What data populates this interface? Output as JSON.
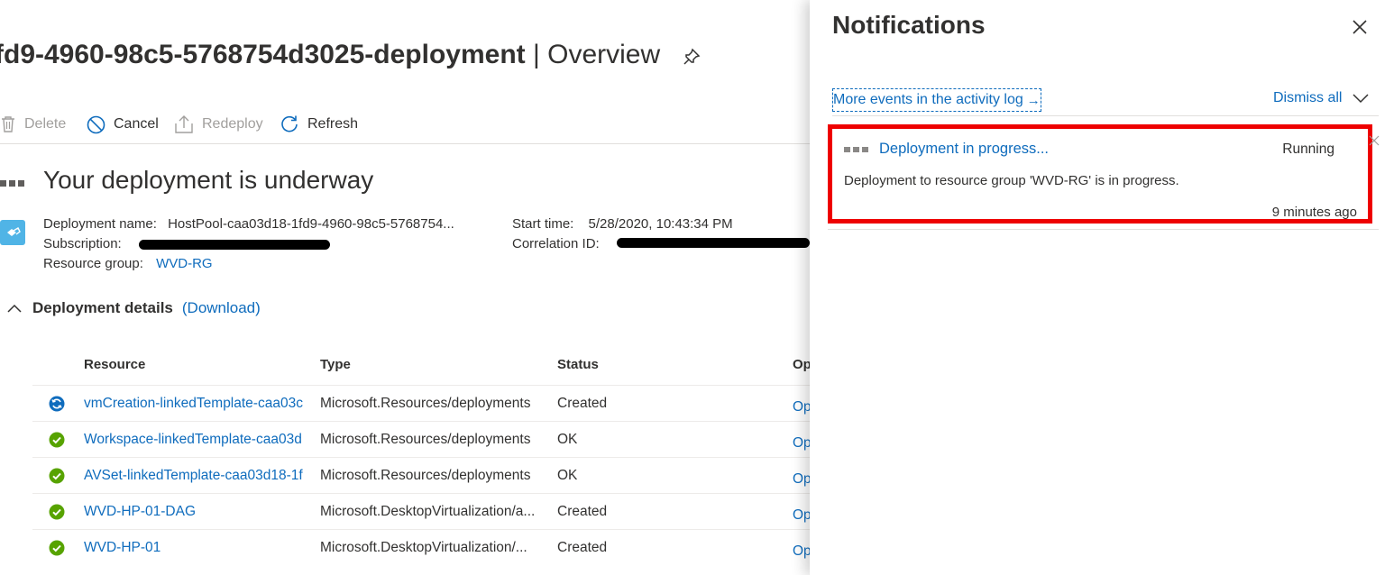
{
  "header": {
    "title_main": "fd9-4960-98c5-5768754d3025-deployment",
    "title_sep": " | ",
    "title_suffix": "Overview"
  },
  "toolbar": {
    "delete_label": "Delete",
    "cancel_label": "Cancel",
    "redeploy_label": "Redeploy",
    "refresh_label": "Refresh"
  },
  "status": {
    "headline": "Your deployment is underway"
  },
  "info": {
    "deployment_name_label": "Deployment name:",
    "deployment_name_value": "HostPool-caa03d18-1fd9-4960-98c5-5768754...",
    "subscription_label": "Subscription:",
    "resource_group_label": "Resource group:",
    "resource_group_value": "WVD-RG",
    "start_time_label": "Start time:",
    "start_time_value": "5/28/2020, 10:43:34 PM",
    "correlation_id_label": "Correlation ID:"
  },
  "details": {
    "collapse_glyph": "^",
    "title": "Deployment details",
    "download_label": "(Download)"
  },
  "table": {
    "headers": [
      "Resource",
      "Type",
      "Status",
      "Op"
    ],
    "rows": [
      {
        "icon": "sync-icon",
        "resource": "vmCreation-linkedTemplate-caa03c",
        "type": "Microsoft.Resources/deployments",
        "status": "Created",
        "op": "Op"
      },
      {
        "icon": "check-circle-icon",
        "resource": "Workspace-linkedTemplate-caa03d",
        "type": "Microsoft.Resources/deployments",
        "status": "OK",
        "op": "Op"
      },
      {
        "icon": "check-circle-icon",
        "resource": "AVSet-linkedTemplate-caa03d18-1f",
        "type": "Microsoft.Resources/deployments",
        "status": "OK",
        "op": "Op"
      },
      {
        "icon": "check-circle-icon",
        "resource": "WVD-HP-01-DAG",
        "type": "Microsoft.DesktopVirtualization/a...",
        "status": "Created",
        "op": "Op"
      },
      {
        "icon": "check-circle-icon",
        "resource": "WVD-HP-01",
        "type": "Microsoft.DesktopVirtualization/...",
        "status": "Created",
        "op": "Op"
      }
    ]
  },
  "notifications": {
    "title": "Notifications",
    "activity_link": "More events in the activity log",
    "activity_arrow": "→",
    "dismiss_all": "Dismiss all",
    "item": {
      "title": "Deployment in progress...",
      "status": "Running",
      "message": "Deployment to resource group 'WVD-RG' is in progress.",
      "time": "9 minutes ago"
    }
  },
  "colors": {
    "link": "#0f6cbd",
    "success": "#57a300",
    "highlight_border": "#ee0000",
    "info_icon": "#50b4e6"
  }
}
